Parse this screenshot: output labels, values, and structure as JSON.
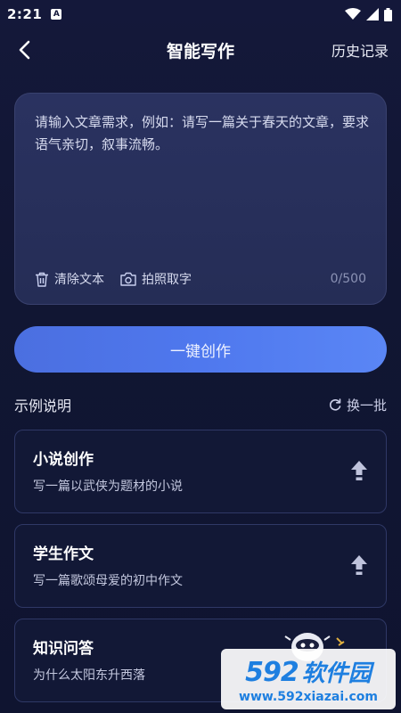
{
  "status_bar": {
    "time": "2:21",
    "notification_badge": "A",
    "icons": [
      "wifi-icon",
      "signal-icon",
      "battery-icon"
    ]
  },
  "header": {
    "title": "智能写作",
    "history_label": "历史记录",
    "back_icon": "chevron-left-icon"
  },
  "input_card": {
    "placeholder": "请输入文章需求，例如：请写一篇关于春天的文章，要求语气亲切，叙事流畅。",
    "clear_label": "清除文本",
    "photo_label": "拍照取字",
    "counter": "0/500"
  },
  "create_button": {
    "label": "一键创作"
  },
  "examples_section": {
    "title": "示例说明",
    "refresh_label": "换一批",
    "items": [
      {
        "title": "小说创作",
        "desc": "写一篇以武侠为题材的小说"
      },
      {
        "title": "学生作文",
        "desc": "写一篇歌颂母爱的初中作文"
      },
      {
        "title": "知识问答",
        "desc": "为什么太阳东升西落"
      }
    ]
  },
  "watermark": {
    "logo_number": "592",
    "logo_text": "软件园",
    "url": "www.592xiazai.com"
  },
  "colors": {
    "background": "#111633",
    "card": "#2a3260",
    "accent": "#4f78ee",
    "muted_text": "#8c93b5"
  }
}
